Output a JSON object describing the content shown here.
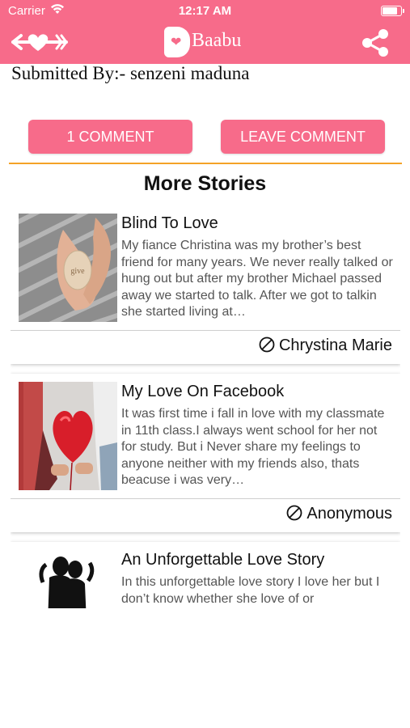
{
  "status_bar": {
    "carrier": "Carrier",
    "time": "12:17 AM"
  },
  "header": {
    "app_name": "Baabu",
    "brand_color": "#f76b8a",
    "icons": [
      "back-arrow-heart-icon",
      "share-icon"
    ]
  },
  "story": {
    "submitted_by": "Submitted By:- senzeni maduna"
  },
  "actions": {
    "comment_count_label": "1 COMMENT",
    "leave_comment_label": "LEAVE COMMENT"
  },
  "more_stories": {
    "heading": "More Stories",
    "items": [
      {
        "title": "Blind To Love",
        "excerpt": "My fiance Christina was my brother’s best friend for many years. We never really talked or hung out but after my brother Michael passed away we started to talk. After we got to talkin she started living at…",
        "author": "Chrystina Marie"
      },
      {
        "title": "My Love On Facebook",
        "excerpt": "It was first time i fall in love with my classmate in 11th class.I always went school for her not for study. But i Never share my feelings to anyone neither with my friends also, thats beacuse i was very…",
        "author": "Anonymous"
      },
      {
        "title": "An Unforgettable Love Story",
        "excerpt": "In this unforgettable love story I love her but I don’t know whether she love of or",
        "author": ""
      }
    ]
  }
}
